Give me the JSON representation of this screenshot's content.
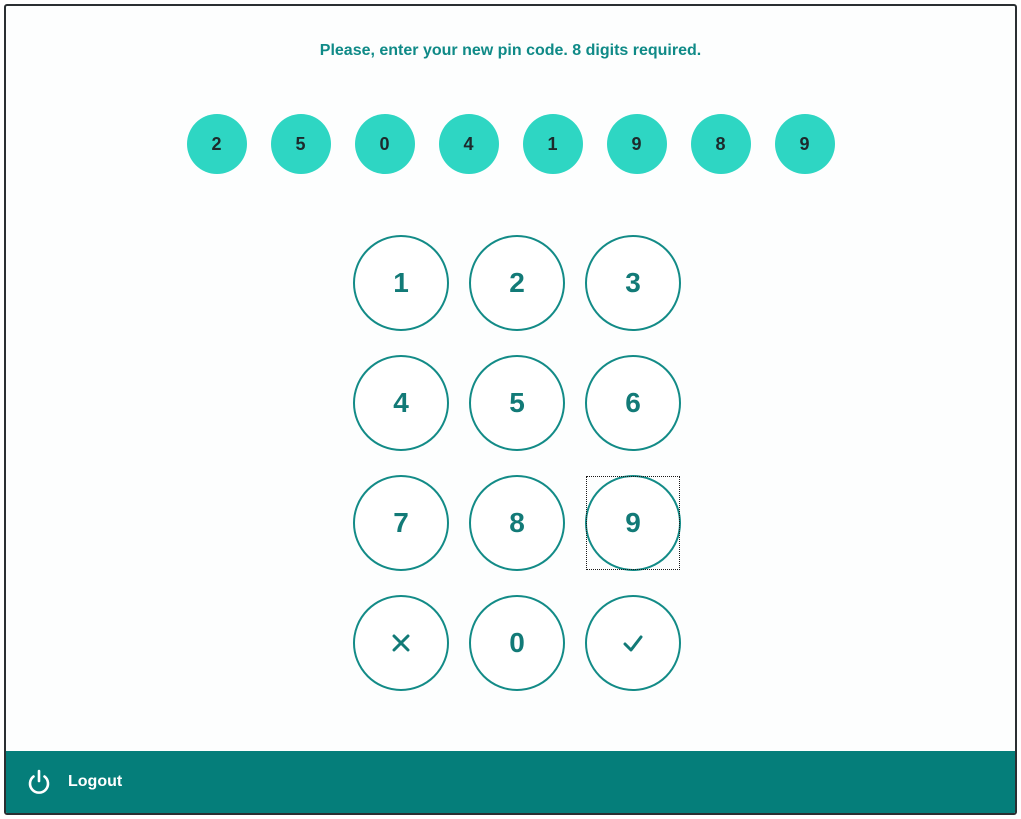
{
  "prompt": "Please, enter your new pin code. 8 digits required.",
  "pin": [
    "2",
    "5",
    "0",
    "4",
    "1",
    "9",
    "8",
    "9"
  ],
  "keypad": {
    "keys": [
      "1",
      "2",
      "3",
      "4",
      "5",
      "6",
      "7",
      "8",
      "9"
    ],
    "zero": "0",
    "clear_icon": "close-icon",
    "confirm_icon": "check-icon",
    "focused_key": "9"
  },
  "footer": {
    "logout_label": "Logout",
    "logout_icon": "power-icon"
  },
  "colors": {
    "accent": "#138b87",
    "pin_fill": "#2ed6c3",
    "footer_bg": "#057e7a",
    "text": "#0f8a87"
  }
}
